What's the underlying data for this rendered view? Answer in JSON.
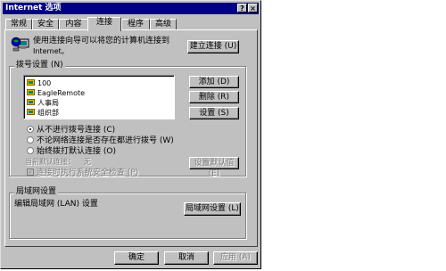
{
  "window": {
    "title": "Internet 选项",
    "help_glyph": "?",
    "close_glyph": "×"
  },
  "tabs": [
    {
      "label": "常规"
    },
    {
      "label": "安全"
    },
    {
      "label": "内容"
    },
    {
      "label": "连接"
    },
    {
      "label": "程序"
    },
    {
      "label": "高级"
    }
  ],
  "active_tab": "连接",
  "setup": {
    "description_line1": "使用连接向导可以将您的计算机连接到",
    "description_line2": "Internet。",
    "button_label": "建立连接 (U)"
  },
  "dialup": {
    "group_label": "拨号设置 (N)",
    "connections": [
      {
        "name": "100"
      },
      {
        "name": "EagleRemote"
      },
      {
        "name": "人事局"
      },
      {
        "name": "组织部"
      }
    ],
    "add_label": "添加 (D)",
    "delete_label": "删除 (R)",
    "settings_label": "设置 (S)",
    "options": [
      {
        "label": "从不进行拨号连接 (C)",
        "checked": true
      },
      {
        "label": "不论网络连接是否存在都进行拨号 (W)",
        "checked": false
      },
      {
        "label": "始终拨打默认连接 (O)",
        "checked": false
      }
    ],
    "default_label": "当前默认连接：",
    "default_value": "无",
    "set_default_label": "设置默认值 (E)",
    "security_check_label": "连接时执行系统安全检查 (P)"
  },
  "lan": {
    "group_label": "局域网设置",
    "description": "编辑局域网 (LAN) 设置",
    "button_label": "局域网设置 (L)"
  },
  "footer": {
    "ok_label": "确定",
    "cancel_label": "取消",
    "apply_label": "应用 (A)"
  },
  "colors": {
    "titlebar": "#000080",
    "face": "#c0c0c0"
  }
}
